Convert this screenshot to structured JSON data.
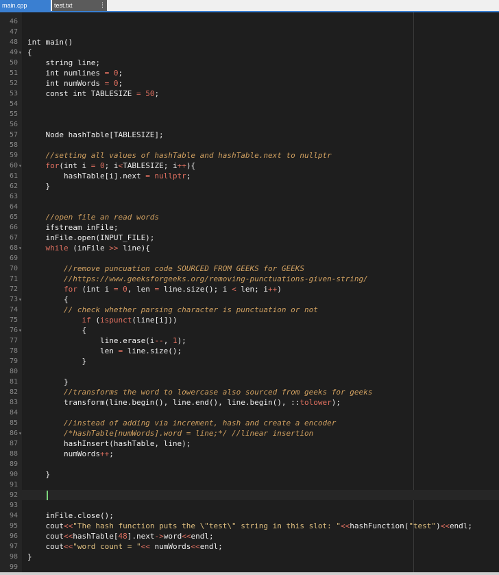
{
  "tabs": [
    {
      "label": "main.cpp",
      "active": true
    },
    {
      "label": "test.txt",
      "active": false
    }
  ],
  "tab_menu_icon": "vertical-ellipsis-icon",
  "colors": {
    "editor_bg": "#1e1e1e",
    "tab_active": "#3a7fd1",
    "comment": "#d0a060",
    "number": "#e07060",
    "caret": "#7cd67c"
  },
  "first_line_number": 46,
  "current_line": 92,
  "lines": [
    {
      "n": "46",
      "fold": false,
      "segs": []
    },
    {
      "n": "47",
      "fold": false,
      "segs": []
    },
    {
      "n": "48",
      "fold": false,
      "segs": [
        {
          "t": "int main()",
          "c": "kw"
        }
      ]
    },
    {
      "n": "49",
      "fold": true,
      "segs": [
        {
          "t": "{",
          "c": ""
        }
      ]
    },
    {
      "n": "50",
      "fold": false,
      "segs": [
        {
          "t": "    string line;",
          "c": ""
        }
      ]
    },
    {
      "n": "51",
      "fold": false,
      "segs": [
        {
          "t": "    int numlines ",
          "c": ""
        },
        {
          "t": "= 0",
          "c": "num"
        },
        {
          "t": ";",
          "c": ""
        }
      ]
    },
    {
      "n": "52",
      "fold": false,
      "segs": [
        {
          "t": "    int numWords ",
          "c": ""
        },
        {
          "t": "= 0",
          "c": "num"
        },
        {
          "t": ";",
          "c": ""
        }
      ]
    },
    {
      "n": "53",
      "fold": false,
      "segs": [
        {
          "t": "    const int TABLESIZE ",
          "c": ""
        },
        {
          "t": "= 50",
          "c": "num"
        },
        {
          "t": ";",
          "c": ""
        }
      ]
    },
    {
      "n": "54",
      "fold": false,
      "segs": []
    },
    {
      "n": "55",
      "fold": false,
      "segs": []
    },
    {
      "n": "56",
      "fold": false,
      "segs": []
    },
    {
      "n": "57",
      "fold": false,
      "segs": [
        {
          "t": "    Node hashTable[TABLESIZE];",
          "c": ""
        }
      ]
    },
    {
      "n": "58",
      "fold": false,
      "segs": []
    },
    {
      "n": "59",
      "fold": false,
      "segs": [
        {
          "t": "    //setting all values of hashTable and hashTable.next to nullptr",
          "c": "cm"
        }
      ]
    },
    {
      "n": "60",
      "fold": true,
      "segs": [
        {
          "t": "    ",
          "c": ""
        },
        {
          "t": "for",
          "c": "op"
        },
        {
          "t": "(int i ",
          "c": ""
        },
        {
          "t": "= 0",
          "c": "num"
        },
        {
          "t": "; i",
          "c": ""
        },
        {
          "t": "<",
          "c": "op"
        },
        {
          "t": "TABLESIZE; i",
          "c": ""
        },
        {
          "t": "++",
          "c": "op"
        },
        {
          "t": "){",
          "c": ""
        }
      ]
    },
    {
      "n": "61",
      "fold": false,
      "segs": [
        {
          "t": "        hashTable[i].next ",
          "c": ""
        },
        {
          "t": "= nullptr",
          "c": "num"
        },
        {
          "t": ";",
          "c": ""
        }
      ]
    },
    {
      "n": "62",
      "fold": false,
      "segs": [
        {
          "t": "    }",
          "c": ""
        }
      ]
    },
    {
      "n": "63",
      "fold": false,
      "segs": []
    },
    {
      "n": "64",
      "fold": false,
      "segs": []
    },
    {
      "n": "65",
      "fold": false,
      "segs": [
        {
          "t": "    //open file an read words",
          "c": "cm"
        }
      ]
    },
    {
      "n": "66",
      "fold": false,
      "segs": [
        {
          "t": "    ifstream inFile;",
          "c": ""
        }
      ]
    },
    {
      "n": "67",
      "fold": false,
      "segs": [
        {
          "t": "    inFile.open(INPUT_FILE);",
          "c": ""
        }
      ]
    },
    {
      "n": "68",
      "fold": true,
      "segs": [
        {
          "t": "    ",
          "c": ""
        },
        {
          "t": "while",
          "c": "op"
        },
        {
          "t": " (inFile ",
          "c": ""
        },
        {
          "t": ">>",
          "c": "op"
        },
        {
          "t": " line){",
          "c": ""
        }
      ]
    },
    {
      "n": "69",
      "fold": false,
      "segs": []
    },
    {
      "n": "70",
      "fold": false,
      "segs": [
        {
          "t": "        //remove puncuation code SOURCED FROM GEEKS for GEEKS",
          "c": "cm"
        }
      ]
    },
    {
      "n": "71",
      "fold": false,
      "segs": [
        {
          "t": "        //https://www.geeksforgeeks.org/removing-punctuations-given-string/",
          "c": "cm"
        }
      ]
    },
    {
      "n": "72",
      "fold": false,
      "segs": [
        {
          "t": "        ",
          "c": ""
        },
        {
          "t": "for",
          "c": "op"
        },
        {
          "t": " (int i ",
          "c": ""
        },
        {
          "t": "= 0",
          "c": "num"
        },
        {
          "t": ", len ",
          "c": ""
        },
        {
          "t": "=",
          "c": "op"
        },
        {
          "t": " line.size(); i ",
          "c": ""
        },
        {
          "t": "<",
          "c": "op"
        },
        {
          "t": " len; i",
          "c": ""
        },
        {
          "t": "++",
          "c": "op"
        },
        {
          "t": ")",
          "c": ""
        }
      ]
    },
    {
      "n": "73",
      "fold": true,
      "segs": [
        {
          "t": "        {",
          "c": ""
        }
      ]
    },
    {
      "n": "74",
      "fold": false,
      "segs": [
        {
          "t": "        // check whether parsing character is punctuation or not",
          "c": "cm"
        }
      ]
    },
    {
      "n": "75",
      "fold": false,
      "segs": [
        {
          "t": "            ",
          "c": ""
        },
        {
          "t": "if",
          "c": "op"
        },
        {
          "t": " (",
          "c": ""
        },
        {
          "t": "ispunct",
          "c": "fn"
        },
        {
          "t": "(line[i]))",
          "c": ""
        }
      ]
    },
    {
      "n": "76",
      "fold": true,
      "segs": [
        {
          "t": "            {",
          "c": ""
        }
      ]
    },
    {
      "n": "77",
      "fold": false,
      "segs": [
        {
          "t": "                line.erase(i",
          "c": ""
        },
        {
          "t": "--",
          "c": "op"
        },
        {
          "t": ", ",
          "c": ""
        },
        {
          "t": "1",
          "c": "num"
        },
        {
          "t": ");",
          "c": ""
        }
      ]
    },
    {
      "n": "78",
      "fold": false,
      "segs": [
        {
          "t": "                len ",
          "c": ""
        },
        {
          "t": "=",
          "c": "op"
        },
        {
          "t": " line.size();",
          "c": ""
        }
      ]
    },
    {
      "n": "79",
      "fold": false,
      "segs": [
        {
          "t": "            }",
          "c": ""
        }
      ]
    },
    {
      "n": "80",
      "fold": false,
      "segs": []
    },
    {
      "n": "81",
      "fold": false,
      "segs": [
        {
          "t": "        }",
          "c": ""
        }
      ]
    },
    {
      "n": "82",
      "fold": false,
      "segs": [
        {
          "t": "        //transforms the word to lowercase also sourced from geeks for geeks",
          "c": "cm"
        }
      ]
    },
    {
      "n": "83",
      "fold": false,
      "segs": [
        {
          "t": "        transform(line.begin(), line.end(), line.begin(), ::",
          "c": ""
        },
        {
          "t": "tolower",
          "c": "fn"
        },
        {
          "t": ");",
          "c": ""
        }
      ]
    },
    {
      "n": "84",
      "fold": false,
      "segs": []
    },
    {
      "n": "85",
      "fold": false,
      "segs": [
        {
          "t": "        //instead of adding via increment, hash and create a encoder",
          "c": "cm"
        }
      ]
    },
    {
      "n": "86",
      "fold": true,
      "segs": [
        {
          "t": "        /*hashTable[numWords].word = line;*/ //linear insertion",
          "c": "cm"
        }
      ]
    },
    {
      "n": "87",
      "fold": false,
      "segs": [
        {
          "t": "        hashInsert(hashTable, line);",
          "c": ""
        }
      ]
    },
    {
      "n": "88",
      "fold": false,
      "segs": [
        {
          "t": "        numWords",
          "c": ""
        },
        {
          "t": "++",
          "c": "op"
        },
        {
          "t": ";",
          "c": ""
        }
      ]
    },
    {
      "n": "89",
      "fold": false,
      "segs": []
    },
    {
      "n": "90",
      "fold": false,
      "segs": [
        {
          "t": "    }",
          "c": ""
        }
      ]
    },
    {
      "n": "91",
      "fold": false,
      "segs": []
    },
    {
      "n": "92",
      "fold": false,
      "segs": []
    },
    {
      "n": "93",
      "fold": false,
      "segs": []
    },
    {
      "n": "94",
      "fold": false,
      "segs": [
        {
          "t": "    inFile.close();",
          "c": ""
        }
      ]
    },
    {
      "n": "95",
      "fold": false,
      "segs": [
        {
          "t": "    cout",
          "c": ""
        },
        {
          "t": "<<",
          "c": "op"
        },
        {
          "t": "\"The hash function puts the \\\"test\\\" string in this slot: \"",
          "c": "str"
        },
        {
          "t": "<<",
          "c": "op"
        },
        {
          "t": "hashFunction(",
          "c": ""
        },
        {
          "t": "\"test\"",
          "c": "str"
        },
        {
          "t": ")",
          "c": ""
        },
        {
          "t": "<<",
          "c": "op"
        },
        {
          "t": "endl;",
          "c": ""
        }
      ]
    },
    {
      "n": "96",
      "fold": false,
      "segs": [
        {
          "t": "    cout",
          "c": ""
        },
        {
          "t": "<<",
          "c": "op"
        },
        {
          "t": "hashTable[",
          "c": ""
        },
        {
          "t": "48",
          "c": "num"
        },
        {
          "t": "].next",
          "c": ""
        },
        {
          "t": "->",
          "c": "op"
        },
        {
          "t": "word",
          "c": ""
        },
        {
          "t": "<<",
          "c": "op"
        },
        {
          "t": "endl;",
          "c": ""
        }
      ]
    },
    {
      "n": "97",
      "fold": false,
      "segs": [
        {
          "t": "    cout",
          "c": ""
        },
        {
          "t": "<<",
          "c": "op"
        },
        {
          "t": "\"word count = \"",
          "c": "str"
        },
        {
          "t": "<<",
          "c": "op"
        },
        {
          "t": " numWords",
          "c": ""
        },
        {
          "t": "<<",
          "c": "op"
        },
        {
          "t": "endl;",
          "c": ""
        }
      ]
    },
    {
      "n": "98",
      "fold": false,
      "segs": [
        {
          "t": "}",
          "c": ""
        }
      ]
    },
    {
      "n": "99",
      "fold": false,
      "segs": []
    }
  ]
}
